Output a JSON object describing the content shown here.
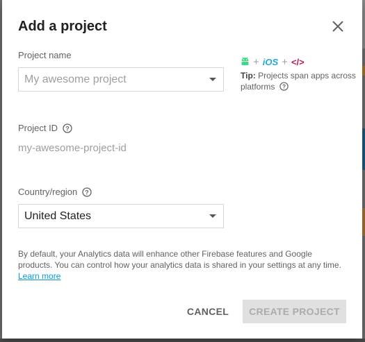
{
  "dialog": {
    "title": "Add a project",
    "close_icon": "close-icon"
  },
  "project_name": {
    "label": "Project name",
    "placeholder": "My awesome project"
  },
  "tip": {
    "icons": [
      "android-icon",
      "ios-icon",
      "web-code-icon"
    ],
    "plus": "+",
    "ios_text": "iOS",
    "web_text": "</>",
    "prefix": "Tip:",
    "text": "Projects span apps across platforms"
  },
  "project_id": {
    "label": "Project ID",
    "value": "my-awesome-project-id"
  },
  "country": {
    "label": "Country/region",
    "selected": "United States"
  },
  "disclaimer": {
    "text": "By default, your Analytics data will enhance other Firebase features and Google products. You can control how your analytics data is shared in your settings at any time.",
    "link": "Learn more"
  },
  "actions": {
    "cancel": "CANCEL",
    "create": "CREATE PROJECT",
    "create_enabled": false
  },
  "colors": {
    "android": "#3ddc84",
    "ios": "#1fa9e0",
    "web": "#c2185b",
    "link": "#039be5"
  }
}
